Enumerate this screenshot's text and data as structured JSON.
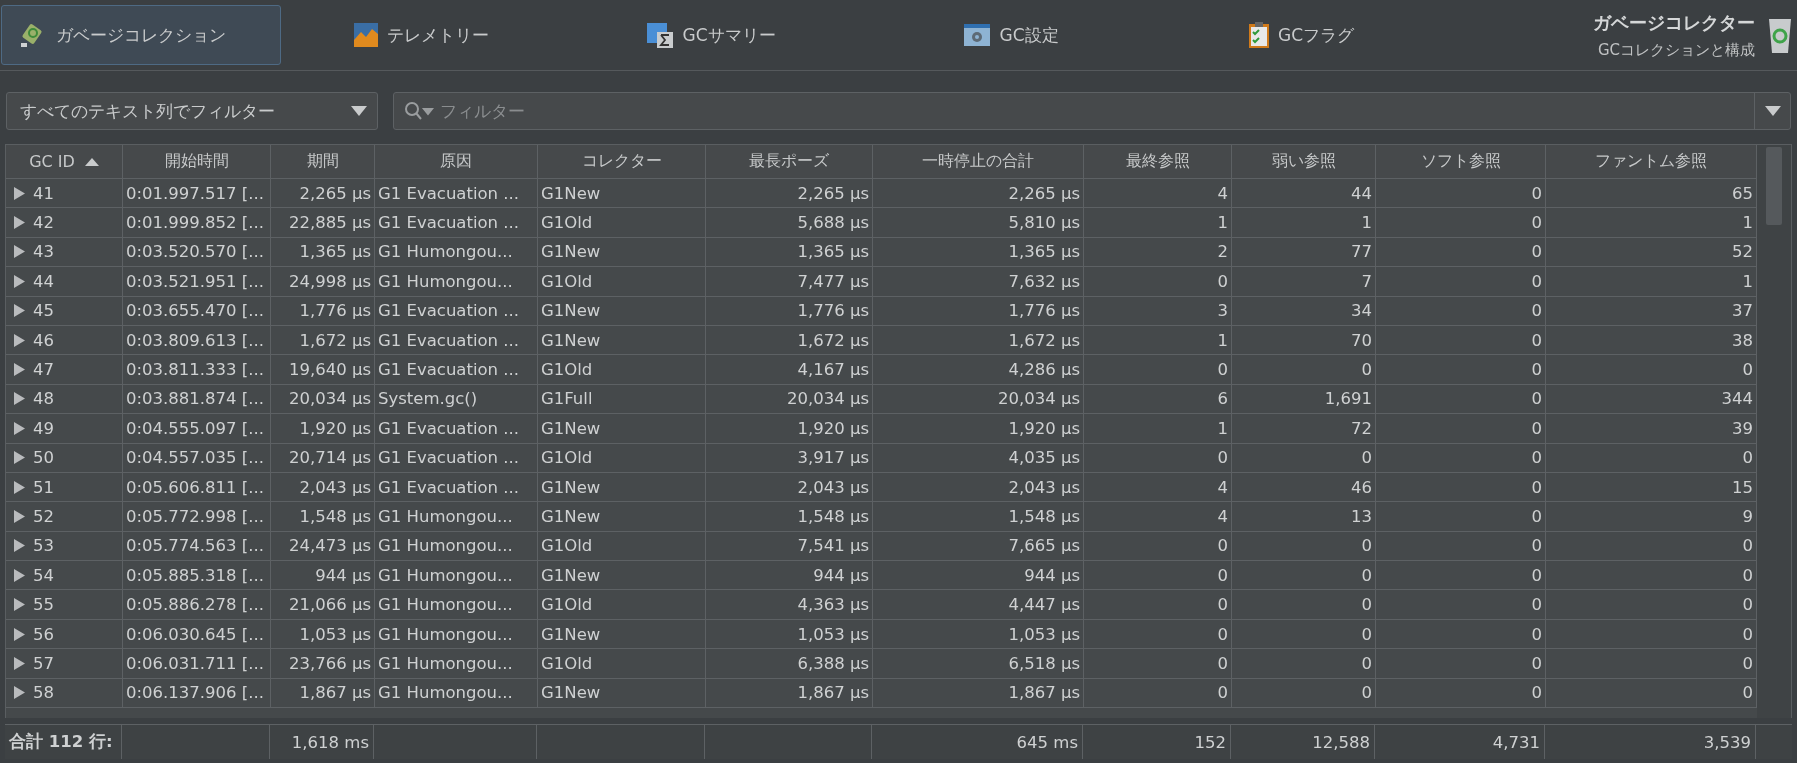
{
  "tabs": [
    {
      "label": "ガベージコレクション",
      "selected": true
    },
    {
      "label": "テレメトリー",
      "selected": false
    },
    {
      "label": "GCサマリー",
      "selected": false
    },
    {
      "label": "GC設定",
      "selected": false
    },
    {
      "label": "GCフラグ",
      "selected": false
    }
  ],
  "header": {
    "title": "ガベージコレクター",
    "subtitle": "GCコレクションと構成"
  },
  "filter": {
    "column_select": "すべてのテキスト列でフィルター",
    "placeholder": "フィルター"
  },
  "table": {
    "columns": [
      {
        "label": "GC ID",
        "sorted": true
      },
      {
        "label": "開始時間",
        "sorted": false
      },
      {
        "label": "期間",
        "sorted": false
      },
      {
        "label": "原因",
        "sorted": false
      },
      {
        "label": "コレクター",
        "sorted": false
      },
      {
        "label": "最長ポーズ",
        "sorted": false
      },
      {
        "label": "一時停止の合計",
        "sorted": false
      },
      {
        "label": "最終参照",
        "sorted": false
      },
      {
        "label": "弱い参照",
        "sorted": false
      },
      {
        "label": "ソフト参照",
        "sorted": false
      },
      {
        "label": "ファントム参照",
        "sorted": false
      }
    ],
    "rows": [
      [
        "41",
        "0:01.997.517 [...",
        "2,265 µs",
        "G1 Evacuation ...",
        "G1New",
        "2,265 µs",
        "2,265 µs",
        "4",
        "44",
        "0",
        "65"
      ],
      [
        "42",
        "0:01.999.852 [...",
        "22,885 µs",
        "G1 Evacuation ...",
        "G1Old",
        "5,688 µs",
        "5,810 µs",
        "1",
        "1",
        "0",
        "1"
      ],
      [
        "43",
        "0:03.520.570 [...",
        "1,365 µs",
        "G1 Humongou...",
        "G1New",
        "1,365 µs",
        "1,365 µs",
        "2",
        "77",
        "0",
        "52"
      ],
      [
        "44",
        "0:03.521.951 [...",
        "24,998 µs",
        "G1 Humongou...",
        "G1Old",
        "7,477 µs",
        "7,632 µs",
        "0",
        "7",
        "0",
        "1"
      ],
      [
        "45",
        "0:03.655.470 [...",
        "1,776 µs",
        "G1 Evacuation ...",
        "G1New",
        "1,776 µs",
        "1,776 µs",
        "3",
        "34",
        "0",
        "37"
      ],
      [
        "46",
        "0:03.809.613 [...",
        "1,672 µs",
        "G1 Evacuation ...",
        "G1New",
        "1,672 µs",
        "1,672 µs",
        "1",
        "70",
        "0",
        "38"
      ],
      [
        "47",
        "0:03.811.333 [...",
        "19,640 µs",
        "G1 Evacuation ...",
        "G1Old",
        "4,167 µs",
        "4,286 µs",
        "0",
        "0",
        "0",
        "0"
      ],
      [
        "48",
        "0:03.881.874 [...",
        "20,034 µs",
        "System.gc()",
        "G1Full",
        "20,034 µs",
        "20,034 µs",
        "6",
        "1,691",
        "0",
        "344"
      ],
      [
        "49",
        "0:04.555.097 [...",
        "1,920 µs",
        "G1 Evacuation ...",
        "G1New",
        "1,920 µs",
        "1,920 µs",
        "1",
        "72",
        "0",
        "39"
      ],
      [
        "50",
        "0:04.557.035 [...",
        "20,714 µs",
        "G1 Evacuation ...",
        "G1Old",
        "3,917 µs",
        "4,035 µs",
        "0",
        "0",
        "0",
        "0"
      ],
      [
        "51",
        "0:05.606.811 [...",
        "2,043 µs",
        "G1 Evacuation ...",
        "G1New",
        "2,043 µs",
        "2,043 µs",
        "4",
        "46",
        "0",
        "15"
      ],
      [
        "52",
        "0:05.772.998 [...",
        "1,548 µs",
        "G1 Humongou...",
        "G1New",
        "1,548 µs",
        "1,548 µs",
        "4",
        "13",
        "0",
        "9"
      ],
      [
        "53",
        "0:05.774.563 [...",
        "24,473 µs",
        "G1 Humongou...",
        "G1Old",
        "7,541 µs",
        "7,665 µs",
        "0",
        "0",
        "0",
        "0"
      ],
      [
        "54",
        "0:05.885.318 [...",
        "944 µs",
        "G1 Humongou...",
        "G1New",
        "944 µs",
        "944 µs",
        "0",
        "0",
        "0",
        "0"
      ],
      [
        "55",
        "0:05.886.278 [...",
        "21,066 µs",
        "G1 Humongou...",
        "G1Old",
        "4,363 µs",
        "4,447 µs",
        "0",
        "0",
        "0",
        "0"
      ],
      [
        "56",
        "0:06.030.645 [...",
        "1,053 µs",
        "G1 Humongou...",
        "G1New",
        "1,053 µs",
        "1,053 µs",
        "0",
        "0",
        "0",
        "0"
      ],
      [
        "57",
        "0:06.031.711 [...",
        "23,766 µs",
        "G1 Humongou...",
        "G1Old",
        "6,388 µs",
        "6,518 µs",
        "0",
        "0",
        "0",
        "0"
      ],
      [
        "58",
        "0:06.137.906 [...",
        "1,867 µs",
        "G1 Humongou...",
        "G1New",
        "1,867 µs",
        "1,867 µs",
        "0",
        "0",
        "0",
        "0"
      ]
    ],
    "footer": {
      "label": "合計 112 行:",
      "duration": "1,618 ms",
      "pause_total": "645 ms",
      "final_refs": "152",
      "weak_refs": "12,588",
      "soft_refs": "4,731",
      "phantom_refs": "3,539"
    }
  }
}
